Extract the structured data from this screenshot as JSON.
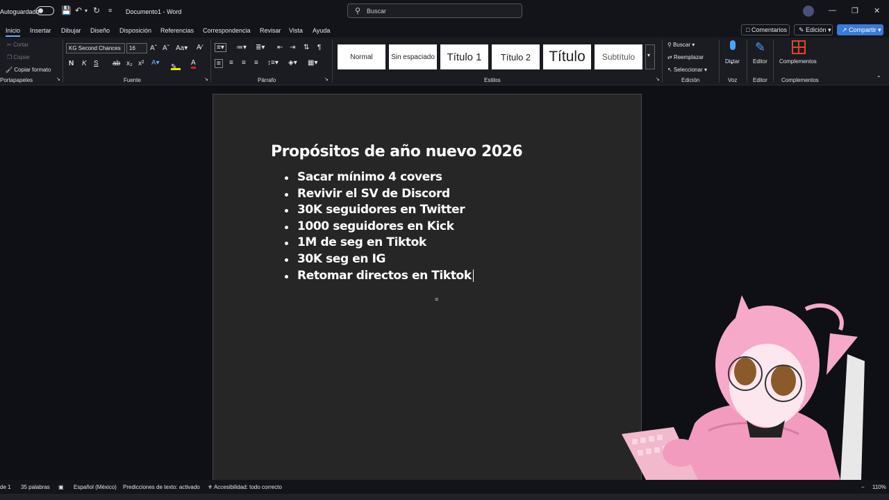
{
  "titlebar": {
    "autosave_label": "Autoguardado",
    "doc_name": "Documento1",
    "separator": "-",
    "app_name": "Word",
    "search_placeholder": "Buscar"
  },
  "tabs": [
    "Inicio",
    "Insertar",
    "Dibujar",
    "Diseño",
    "Disposición",
    "Referencias",
    "Correspondencia",
    "Revisar",
    "Vista",
    "Ayuda"
  ],
  "right_buttons": {
    "comments": "Comentarios",
    "editing": "Edición",
    "share": "Compartir"
  },
  "ribbon": {
    "clipboard": {
      "cut": "Cortar",
      "copy": "Copiar",
      "format_painter": "Copiar formato",
      "group": "Portapapeles"
    },
    "font": {
      "font_name": "KG Second Chances",
      "font_size": "16",
      "group": "Fuente",
      "bold": "N",
      "italic": "K",
      "underline": "S"
    },
    "paragraph": {
      "group": "Párrafo"
    },
    "styles": {
      "items": [
        "Normal",
        "Sin espaciado",
        "Título 1",
        "Título 2",
        "Título",
        "Subtítulo"
      ],
      "group": "Estilos"
    },
    "editing": {
      "find": "Buscar",
      "replace": "Reemplazar",
      "select": "Seleccionar",
      "group": "Edición"
    },
    "voice": {
      "dictate": "Dictar",
      "group": "Voz"
    },
    "editor": {
      "label": "Editor",
      "group": "Editor"
    },
    "addins": {
      "label": "Complementos",
      "group": "Complementos"
    }
  },
  "document": {
    "title": "Propósitos de año nuevo 2026",
    "items": [
      "Sacar mínimo 4 covers",
      "Revivir el SV de Discord",
      "30K seguidores en Twitter",
      "1000 seguidores en Kick",
      "1M de seg en Tiktok",
      "30K seg en IG",
      "Retomar directos en Tiktok"
    ]
  },
  "statusbar": {
    "page": "de 1",
    "words": "35 palabras",
    "language": "Español (México)",
    "predictions": "Predicciones de texto: activado",
    "accessibility": "Accesibilidad: todo correcto",
    "zoom": "110%"
  }
}
